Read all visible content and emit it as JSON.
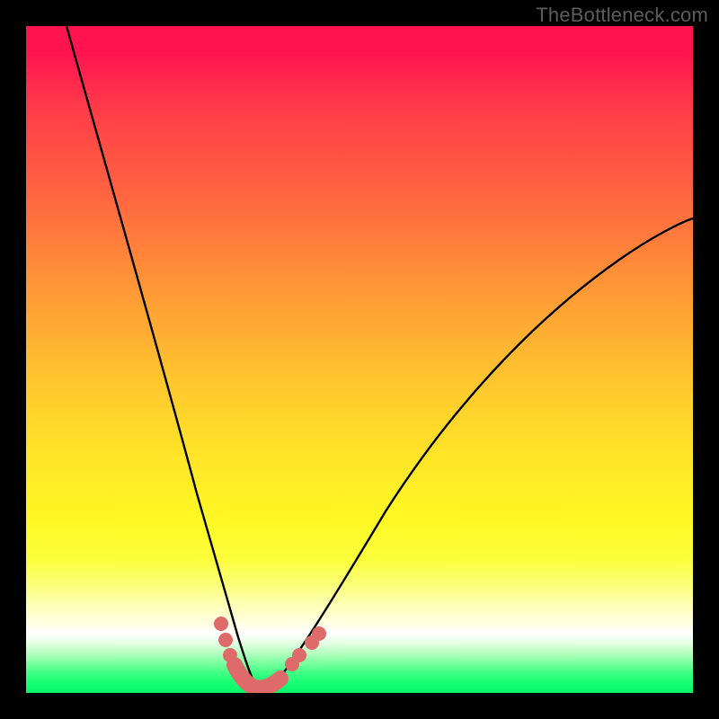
{
  "watermark": "TheBottleneck.com",
  "colors": {
    "bead": "#de6a6a",
    "curve": "#000000",
    "frame": "#000000"
  },
  "chart_data": {
    "type": "line",
    "title": "",
    "xlabel": "",
    "ylabel": "",
    "xlim": [
      0,
      100
    ],
    "ylim": [
      0,
      100
    ],
    "grid": false,
    "legend": false,
    "note": "A bottleneck V-curve. x is relative component strength; y is bottleneck percentage. The valley near x≈34 is the balanced point (0% bottleneck). Background hue encodes bottleneck severity from green (low, bottom) to red (high, top).",
    "series": [
      {
        "name": "left-branch",
        "x": [
          5,
          8,
          12,
          16,
          20,
          24,
          27,
          29,
          31,
          33,
          34
        ],
        "y": [
          100,
          86,
          70,
          55,
          40,
          27,
          17,
          10,
          4,
          1,
          0
        ]
      },
      {
        "name": "right-branch",
        "x": [
          34,
          36,
          40,
          46,
          54,
          64,
          76,
          90,
          100
        ],
        "y": [
          0,
          1,
          4,
          10,
          20,
          33,
          48,
          62,
          71
        ]
      }
    ],
    "annotations": {
      "optimal_x": 34,
      "beads_left": [
        {
          "x": 29.0,
          "y": 10.0
        },
        {
          "x": 29.7,
          "y": 7.5
        },
        {
          "x": 30.5,
          "y": 5.0
        }
      ],
      "beads_right": [
        {
          "x": 40.0,
          "y": 4.0
        },
        {
          "x": 41.0,
          "y": 5.2
        },
        {
          "x": 43.0,
          "y": 7.2
        },
        {
          "x": 44.0,
          "y": 8.5
        }
      ],
      "sausage_path": [
        {
          "x": 31.0,
          "y": 3.8
        },
        {
          "x": 32.5,
          "y": 1.2
        },
        {
          "x": 34.0,
          "y": 0.4
        },
        {
          "x": 36.0,
          "y": 0.4
        },
        {
          "x": 38.0,
          "y": 1.8
        }
      ]
    }
  }
}
